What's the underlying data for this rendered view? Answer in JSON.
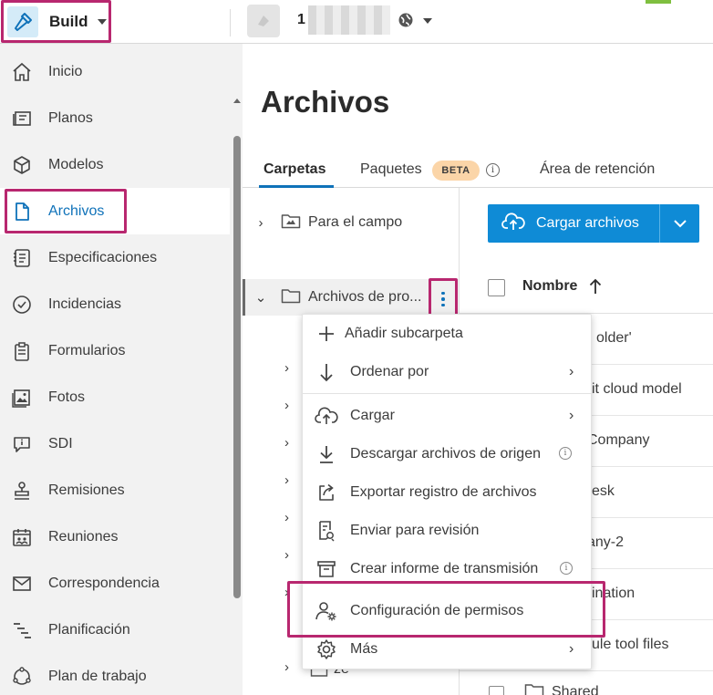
{
  "app": {
    "name": "Build"
  },
  "project": {
    "number": "1"
  },
  "sidebar": {
    "items": [
      {
        "label": "Inicio",
        "icon": "home-icon"
      },
      {
        "label": "Planos",
        "icon": "sheets-icon"
      },
      {
        "label": "Modelos",
        "icon": "cube-icon"
      },
      {
        "label": "Archivos",
        "icon": "file-icon",
        "active": true
      },
      {
        "label": "Especificaciones",
        "icon": "specs-icon"
      },
      {
        "label": "Incidencias",
        "icon": "check-circle-icon"
      },
      {
        "label": "Formularios",
        "icon": "clipboard-icon"
      },
      {
        "label": "Fotos",
        "icon": "photo-icon"
      },
      {
        "label": "SDI",
        "icon": "chat-info-icon"
      },
      {
        "label": "Remisiones",
        "icon": "stamp-icon"
      },
      {
        "label": "Reuniones",
        "icon": "calendar-people-icon"
      },
      {
        "label": "Correspondencia",
        "icon": "mail-icon"
      },
      {
        "label": "Planificación",
        "icon": "schedule-icon"
      },
      {
        "label": "Plan de trabajo",
        "icon": "workplan-icon"
      }
    ]
  },
  "main": {
    "title": "Archivos",
    "tabs": [
      {
        "label": "Carpetas",
        "active": true
      },
      {
        "label": "Paquetes",
        "badge": "BETA"
      },
      {
        "label": "Área de retención"
      }
    ]
  },
  "tree": {
    "items": [
      {
        "label": "Para el campo"
      },
      {
        "label": "Archivos de pro...",
        "selected": true
      }
    ],
    "partial_label": "ze"
  },
  "files": {
    "upload_label": "Cargar archivos",
    "column_name": "Nombre",
    "rows": [
      {
        "name": "older'"
      },
      {
        "name": "it cloud model"
      },
      {
        "name": "Company"
      },
      {
        "name": "esk"
      },
      {
        "name": "any-2"
      },
      {
        "name": "ination"
      },
      {
        "name": "ule tool files"
      }
    ],
    "last_row": "Shared"
  },
  "context_menu": {
    "items": [
      {
        "label": "Añadir subcarpeta",
        "icon": "plus-icon"
      },
      {
        "label": "Ordenar por",
        "icon": "arrow-down-icon",
        "submenu": true
      },
      {
        "label": "Cargar",
        "icon": "cloud-upload-icon",
        "submenu": true
      },
      {
        "label": "Descargar archivos de origen",
        "icon": "download-icon",
        "info": true
      },
      {
        "label": "Exportar registro de archivos",
        "icon": "export-icon"
      },
      {
        "label": "Enviar para revisión",
        "icon": "review-icon"
      },
      {
        "label": "Crear informe de transmisión",
        "icon": "transmittal-icon",
        "info": true
      },
      {
        "label": "Configuración de permisos",
        "icon": "user-gear-icon",
        "highlighted": true
      },
      {
        "label": "Más",
        "icon": "gear-icon",
        "submenu": true
      }
    ]
  },
  "colors": {
    "accent": "#0f72b9",
    "primary_button": "#0f8bd6",
    "highlight": "#b8276f",
    "beta_badge": "#fbd5a8"
  }
}
